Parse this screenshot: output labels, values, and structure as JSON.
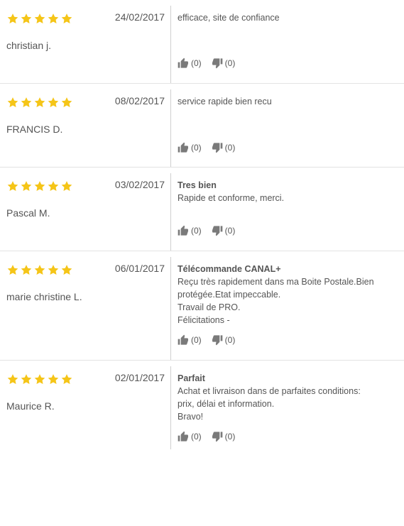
{
  "colors": {
    "star": "#f5c518",
    "thumb": "#7a7a7a",
    "divider": "#cfcfcf"
  },
  "reviews": [
    {
      "rating": 5,
      "date": "24/02/2017",
      "author": "christian j.",
      "title": "",
      "text": "efficace, site de confiance",
      "likes": "(0)",
      "dislikes": "(0)"
    },
    {
      "rating": 5,
      "date": "08/02/2017",
      "author": "FRANCIS D.",
      "title": "",
      "text": "service rapide bien recu",
      "likes": "(0)",
      "dislikes": "(0)"
    },
    {
      "rating": 5,
      "date": "03/02/2017",
      "author": "Pascal M.",
      "title": "Tres bien",
      "text": "Rapide et conforme, merci.",
      "likes": "(0)",
      "dislikes": "(0)"
    },
    {
      "rating": 5,
      "date": "06/01/2017",
      "author": "marie christine L.",
      "title": "Télécommande CANAL+",
      "text": "Reçu très rapidement dans ma Boite Postale.Bien\nprotégée.Etat impeccable.\nTravail de PRO.\nFélicitations -",
      "likes": "(0)",
      "dislikes": "(0)"
    },
    {
      "rating": 5,
      "date": "02/01/2017",
      "author": "Maurice R.",
      "title": "Parfait",
      "text": "Achat et livraison dans de parfaites conditions:\nprix, délai et information.\nBravo!",
      "likes": "(0)",
      "dislikes": "(0)"
    }
  ]
}
